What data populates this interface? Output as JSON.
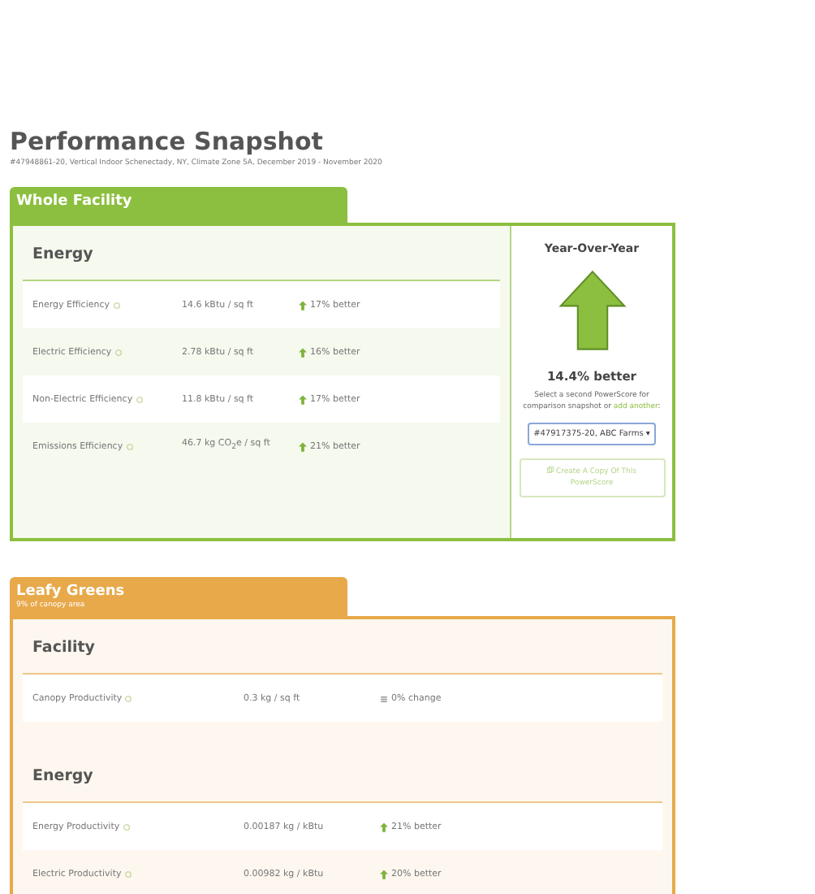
{
  "title": "Performance Snapshot",
  "subtitle": "#47948861-20, Vertical Indoor Schenectady, NY, Climate Zone 5A, December 2019 - November 2020",
  "sections": [
    {
      "tab": "Whole Facility",
      "color": "#8cbf3f",
      "groups": [
        {
          "heading": "Energy",
          "rows": [
            {
              "label": "Energy Efficiency",
              "value": "14.6 kBtu / sq ft",
              "kind": "up",
              "change": "17% better"
            },
            {
              "label": "Electric Efficiency",
              "value": "2.78 kBtu / sq ft",
              "kind": "up",
              "change": "16% better"
            },
            {
              "label": "Non-Electric Efficiency",
              "value": "11.8 kBtu / sq ft",
              "kind": "up",
              "change": "17% better"
            },
            {
              "label": "Emissions Efficiency",
              "value": "46.7 kg CO$_{2}$e / sq ft",
              "kind": "up",
              "change": "21% better"
            }
          ]
        }
      ],
      "side": {
        "heading": "Year-Over-Year",
        "result": "14.4% better",
        "prompt": "Select a second PowerScore for comparison snapshot or",
        "link": "add another",
        "colon": ":",
        "select": "#47917375-20, ABC Farms",
        "select_caret": "▾",
        "button": "Create A Copy Of This PowerScore"
      }
    },
    {
      "tab": "Leafy Greens",
      "tab_note": "9% of canopy area",
      "color": "#e8a94a",
      "groups": [
        {
          "heading": "Facility",
          "rows": [
            {
              "label": "Canopy Productivity",
              "value": "0.3 kg / sq ft",
              "kind": "flat",
              "change": "0% change"
            }
          ]
        },
        {
          "heading": "Energy",
          "rows": [
            {
              "label": "Energy Productivity",
              "value": "0.00187 kg / kBtu",
              "kind": "up",
              "change": "21% better"
            },
            {
              "label": "Electric Productivity",
              "value": "0.00982 kg / kBtu",
              "kind": "up",
              "change": "20% better"
            }
          ]
        }
      ]
    }
  ]
}
